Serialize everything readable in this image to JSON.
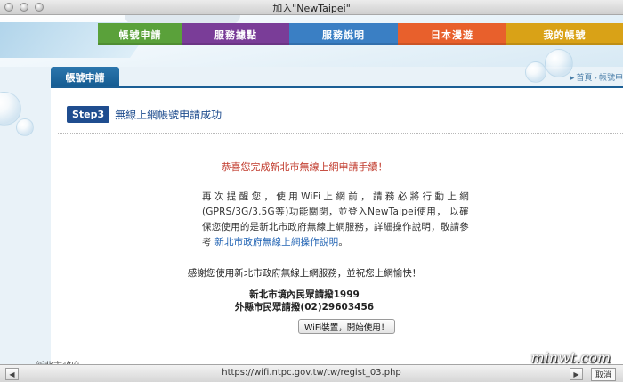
{
  "window": {
    "title": "加入\"NewTaipei\""
  },
  "nav": {
    "items": [
      {
        "label": "帳號申請",
        "color": "#5aa13a"
      },
      {
        "label": "服務據點",
        "color": "#7a3d98"
      },
      {
        "label": "服務說明",
        "color": "#3a7fc4"
      },
      {
        "label": "日本漫遊",
        "color": "#e8602c"
      },
      {
        "label": "我的帳號",
        "color": "#d9a217"
      }
    ]
  },
  "tabs": {
    "active": "帳號申請"
  },
  "breadcrumb": {
    "home": "首頁",
    "sep": "›",
    "current": "帳號申"
  },
  "step": {
    "badge": "Step3",
    "title": "無線上網帳號申請成功"
  },
  "main": {
    "success": "恭喜您完成新北市無線上網申請手續！",
    "para_text": "再次提醒您，使用WiFi上網前，請務必將行動上網(GPRS/3G/3.5G等)功能關閉，並登入NewTaipei使用， 以確保您使用的是新北市政府無線上網服務，詳細操作說明，敬請參考 ",
    "para_link": "新北市政府無線上網操作說明",
    "para_end": "。",
    "thanks": "感謝您使用新北市政府無線上網服務，並祝您上網愉快！",
    "hotline1": "新北市境內民眾請撥1999",
    "hotline2": "外縣市民眾請撥(02)29603456",
    "button": "WiFi裝置，開始使用！"
  },
  "statusbar": {
    "url": "https://wifi.ntpc.gov.tw/tw/regist_03.php",
    "cancel": "取消"
  },
  "footer": {
    "logo_text": "新北市政府"
  },
  "watermark": "minwt.com"
}
